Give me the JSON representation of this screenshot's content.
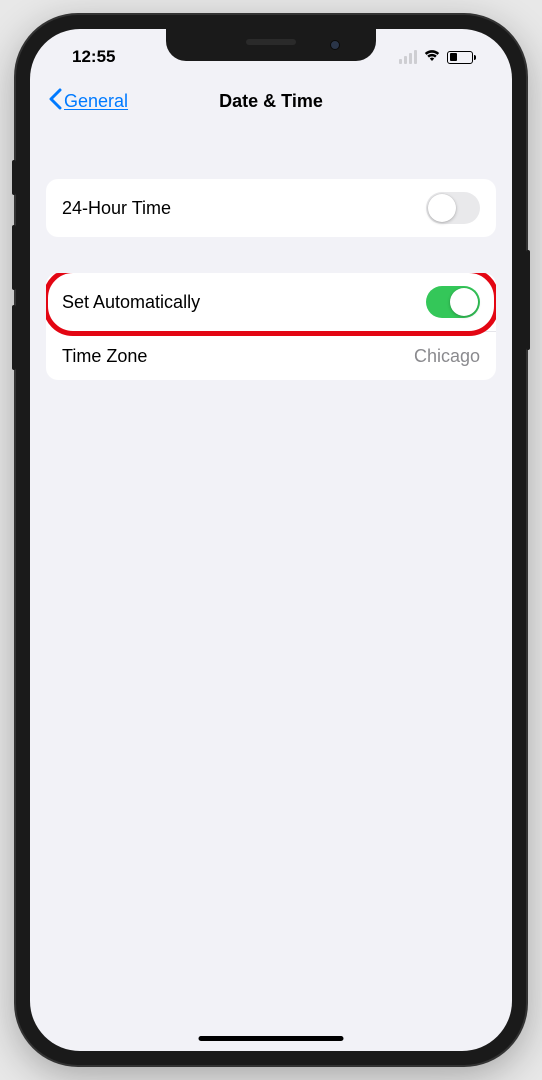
{
  "statusBar": {
    "time": "12:55"
  },
  "navBar": {
    "backLabel": "General",
    "title": "Date & Time"
  },
  "groups": {
    "first": {
      "twentyFourHour": {
        "label": "24-Hour Time",
        "enabled": false
      }
    },
    "second": {
      "setAutomatically": {
        "label": "Set Automatically",
        "enabled": true,
        "highlighted": true
      },
      "timeZone": {
        "label": "Time Zone",
        "value": "Chicago"
      }
    }
  }
}
